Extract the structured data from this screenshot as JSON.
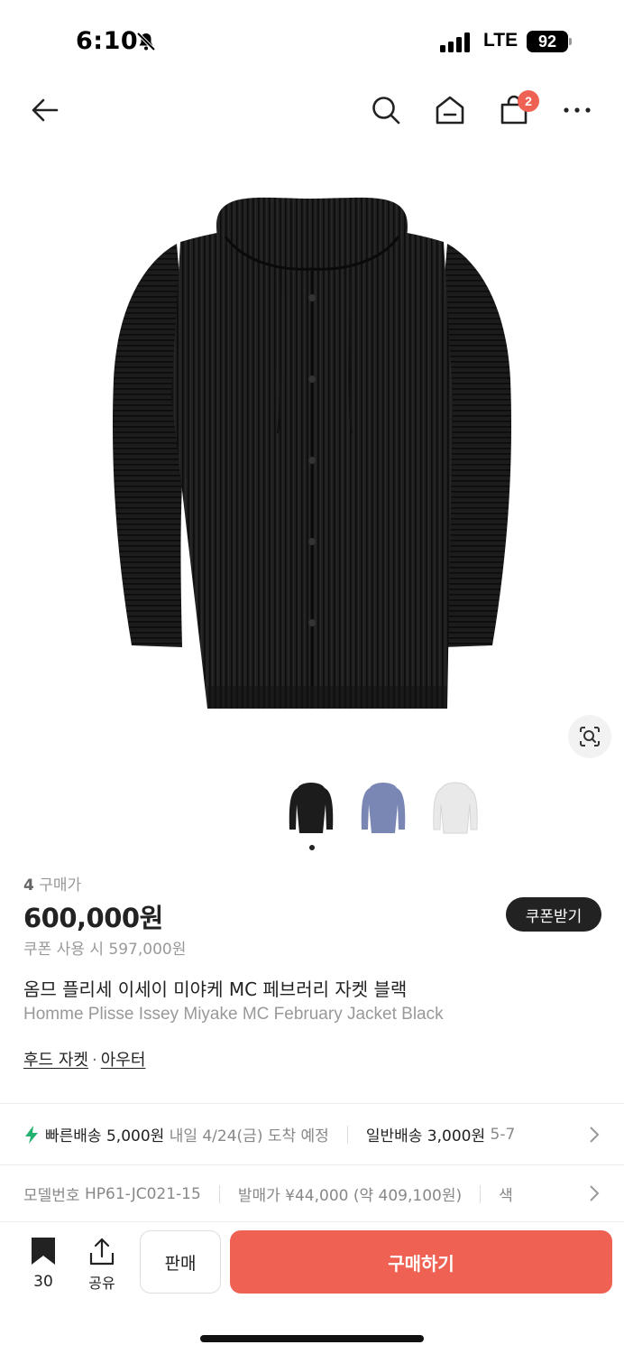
{
  "status_bar": {
    "time": "6:10",
    "network": "LTE",
    "battery": "92"
  },
  "nav": {
    "cart_count": "2"
  },
  "thumbnails": [
    {
      "color": "#1c1c1c",
      "name": "black"
    },
    {
      "color": "#7a86b4",
      "name": "blue"
    },
    {
      "color": "#e9e9ea",
      "name": "white"
    }
  ],
  "product": {
    "trade_count_num": "4",
    "trade_count_label": "구매가",
    "price": "600,000원",
    "coupon_button": "쿠폰받기",
    "coupon_price": "쿠폰 사용 시 597,000원",
    "title_ko": "옴므 플리세 이세이 미야케 MC 페브러리 자켓 블랙",
    "title_en": "Homme Plisse Issey Miyake MC February Jacket Black",
    "categories": [
      "후드 자켓",
      "아우터"
    ],
    "category_sep": "·"
  },
  "shipping": {
    "fast_label": "빠른배송",
    "fast_price": "5,000원",
    "fast_eta": "내일 4/24(금) 도착 예정",
    "normal_label": "일반배송",
    "normal_price": "3,000원",
    "normal_eta": "5-7"
  },
  "spec": {
    "model_label": "모델번호",
    "model_value": "HP61-JC021-15",
    "release_label": "발매가",
    "release_value": "¥44,000 (약 409,100원)",
    "color_label": "색"
  },
  "bottom_bar": {
    "bookmark_count": "30",
    "share_label": "공유",
    "sell_label": "판매",
    "buy_label": "구매하기"
  },
  "colors": {
    "accent": "#ef6253",
    "text": "#222222",
    "subtext": "#999999"
  }
}
